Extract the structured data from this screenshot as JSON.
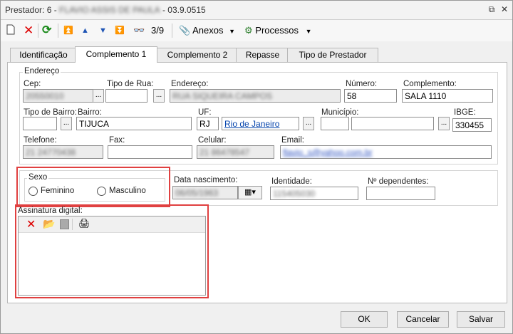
{
  "window": {
    "title_prefix": "Prestador: 6 - ",
    "title_redacted": "FLAVIO ASSIS DE PAULA",
    "title_suffix": " - 03.9.0515"
  },
  "toolbar": {
    "record_position": "3/9",
    "anexos_label": "Anexos",
    "processos_label": "Processos"
  },
  "tabs": [
    {
      "label": "Identificação"
    },
    {
      "label": "Complemento 1"
    },
    {
      "label": "Complemento 2"
    },
    {
      "label": "Repasse"
    },
    {
      "label": "Tipo de Prestador"
    }
  ],
  "endereco": {
    "group_label": "Endereço",
    "cep_label": "Cep:",
    "cep_value": "20550010",
    "tipo_rua_label": "Tipo de Rua:",
    "endereco_label": "Endereço:",
    "endereco_value": "RUA SIQUEIRA CAMPOS",
    "numero_label": "Número:",
    "numero_value": "58",
    "complemento_label": "Complemento:",
    "complemento_value": "SALA 1110",
    "tipo_bairro_label": "Tipo de Bairro:",
    "bairro_label": "Bairro:",
    "bairro_value": "TIJUCA",
    "uf_label": "UF:",
    "uf_value": "RJ",
    "uf_name": "Rio de Janeiro",
    "municipio_label": "Município:",
    "ibge_label": "IBGE:",
    "ibge_value": "330455",
    "telefone_label": "Telefone:",
    "telefone_value": "21 24770438",
    "fax_label": "Fax:",
    "celular_label": "Celular:",
    "celular_value": "21 86478547",
    "email_label": "Email:",
    "email_value": "flavio_s@yahoo.com.br"
  },
  "sexo": {
    "group_label": "Sexo",
    "feminino": "Feminino",
    "masculino": "Masculino"
  },
  "data_nascimento": {
    "label": "Data nascimento:",
    "value": "06/05/1963"
  },
  "identidade": {
    "label": "Identidade:",
    "value": "115405030"
  },
  "dependentes": {
    "label": "Nº dependentes:"
  },
  "assinatura": {
    "label": "Assinatura digital:"
  },
  "buttons": {
    "ok": "OK",
    "cancelar": "Cancelar",
    "salvar": "Salvar"
  },
  "colors": {
    "highlight": "#e04040",
    "link": "#0645ad"
  }
}
